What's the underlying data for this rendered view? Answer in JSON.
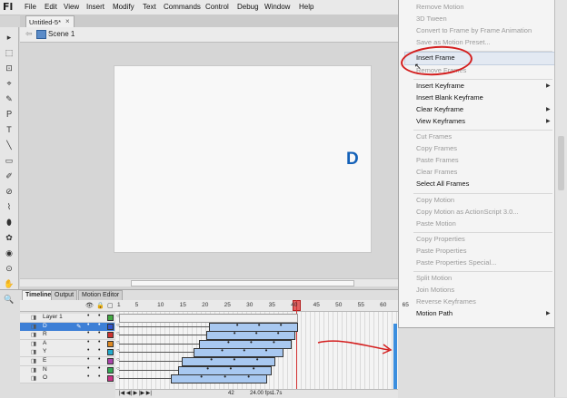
{
  "app": {
    "logo": "Fl"
  },
  "menubar": {
    "items": [
      "File",
      "Edit",
      "View",
      "Insert",
      "Modify",
      "Text",
      "Commands",
      "Control",
      "Debug",
      "Window",
      "Help"
    ]
  },
  "document": {
    "tab_title": "Untitled-5*",
    "close_glyph": "×"
  },
  "editbar": {
    "scene_label": "Scene 1",
    "back_glyph": "⇦"
  },
  "stage": {
    "letter": "D",
    "letter_color": "#1461b8"
  },
  "tools": [
    "▸",
    "⬚",
    "⊡",
    "⌖",
    "✎",
    "Ｐ",
    "T",
    "╲",
    "▭",
    "✐",
    "⊘",
    "⌇",
    "⬮",
    "✿",
    "◉",
    "⊙",
    "✋",
    "🔍"
  ],
  "timeline": {
    "tabs": [
      "Timeline",
      "Output",
      "Motion Editor"
    ],
    "column_icons": [
      "👁",
      "🔒",
      "▢"
    ],
    "frame_numbers": [
      "1",
      "5",
      "10",
      "15",
      "20",
      "25",
      "30",
      "35",
      "40",
      "45",
      "50",
      "55",
      "60",
      "65"
    ],
    "layers": [
      {
        "name": "Layer 1",
        "color": "#44aa44",
        "selected": false
      },
      {
        "name": "D",
        "color": "#3355cc",
        "selected": true
      },
      {
        "name": "R",
        "color": "#cc3333",
        "selected": false
      },
      {
        "name": "A",
        "color": "#dd8822",
        "selected": false
      },
      {
        "name": "Y",
        "color": "#22aacc",
        "selected": false
      },
      {
        "name": "E",
        "color": "#aa44aa",
        "selected": false
      },
      {
        "name": "N",
        "color": "#33aa55",
        "selected": false
      },
      {
        "name": "O",
        "color": "#cc3388",
        "selected": false
      }
    ],
    "status": {
      "current_frame": "42",
      "fps": "24.00 fps",
      "time": "1.7s"
    }
  },
  "context_menu": {
    "items": [
      {
        "label": "Remove Motion",
        "disabled": true,
        "submenu": false
      },
      {
        "label": "3D Tween",
        "disabled": true,
        "submenu": false
      },
      {
        "label": "Convert to Frame by Frame Animation",
        "disabled": true,
        "submenu": false
      },
      {
        "label": "Save as Motion Preset...",
        "disabled": true,
        "submenu": false
      },
      {
        "sep": true
      },
      {
        "label": "Insert Frame",
        "disabled": false,
        "submenu": false,
        "highlighted": true
      },
      {
        "label": "Remove Frames",
        "disabled": true,
        "submenu": false
      },
      {
        "sep": true
      },
      {
        "label": "Insert Keyframe",
        "disabled": false,
        "submenu": true
      },
      {
        "label": "Insert Blank Keyframe",
        "disabled": false,
        "submenu": false
      },
      {
        "label": "Clear Keyframe",
        "disabled": false,
        "submenu": true
      },
      {
        "label": "View Keyframes",
        "disabled": false,
        "submenu": true
      },
      {
        "sep": true
      },
      {
        "label": "Cut Frames",
        "disabled": true,
        "submenu": false
      },
      {
        "label": "Copy Frames",
        "disabled": true,
        "submenu": false
      },
      {
        "label": "Paste Frames",
        "disabled": true,
        "submenu": false
      },
      {
        "label": "Clear Frames",
        "disabled": true,
        "submenu": false
      },
      {
        "label": "Select All Frames",
        "disabled": false,
        "submenu": false
      },
      {
        "sep": true
      },
      {
        "label": "Copy Motion",
        "disabled": true,
        "submenu": false
      },
      {
        "label": "Copy Motion as ActionScript 3.0...",
        "disabled": true,
        "submenu": false
      },
      {
        "label": "Paste Motion",
        "disabled": true,
        "submenu": false
      },
      {
        "sep": true
      },
      {
        "label": "Copy Properties",
        "disabled": true,
        "submenu": false
      },
      {
        "label": "Paste Properties",
        "disabled": true,
        "submenu": false
      },
      {
        "label": "Paste Properties Special...",
        "disabled": true,
        "submenu": false
      },
      {
        "sep": true
      },
      {
        "label": "Split Motion",
        "disabled": true,
        "submenu": false
      },
      {
        "label": "Join Motions",
        "disabled": true,
        "submenu": false
      },
      {
        "label": "Reverse Keyframes",
        "disabled": true,
        "submenu": false
      },
      {
        "label": "Motion Path",
        "disabled": false,
        "submenu": true
      }
    ],
    "annotation_color": "#d41f1f"
  }
}
